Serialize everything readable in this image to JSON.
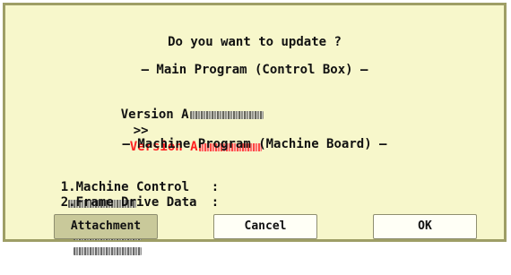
{
  "dialog": {
    "question": "Do you want to update ?",
    "main_program_header": "— Main Program (Control Box) —",
    "version_current_prefix": "Version A",
    "arrow": ">>",
    "version_new_prefix": "Version A",
    "machine_program_header": "— Machine Program (Machine Board) —",
    "item1_label": "1.Machine Control",
    "item2_label": "2.Frame Drive Data",
    "separator": ":",
    "item1_arrow": ">>",
    "item2_arrow": ">>"
  },
  "buttons": {
    "attachment": "Attachment",
    "cancel": "Cancel",
    "ok": "OK"
  },
  "colors": {
    "dialog_bg": "#f7f7cb",
    "border": "#9e9e66",
    "new_version": "#ff2020",
    "attachment_bg": "#c9c99a",
    "button_bg": "#fffff6"
  }
}
